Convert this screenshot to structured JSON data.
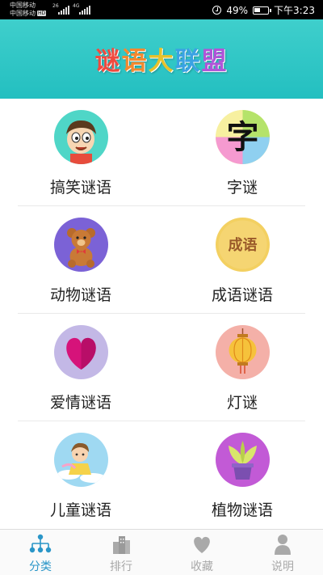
{
  "status_bar": {
    "carrier_1": "中国移动",
    "carrier_2": "中国移动",
    "hd_badge": "HD",
    "net_1": "26",
    "net_2": "4G",
    "battery_percent": "49%",
    "battery_level": 0.49,
    "time": "下午3:23"
  },
  "header": {
    "title_chars": [
      "谜",
      "语",
      "大",
      "联",
      "盟"
    ]
  },
  "categories": [
    {
      "label": "搞笑谜语",
      "icon": "funny-boy-icon",
      "bg": "#4fd6c7"
    },
    {
      "label": "字谜",
      "icon": "character-zi-icon",
      "bg": "#f7f0a0"
    },
    {
      "label": "动物谜语",
      "icon": "teddy-bear-icon",
      "bg": "#7b62d6"
    },
    {
      "label": "成语谜语",
      "icon": "idiom-chengyu-icon",
      "bg": "#f3d061",
      "icon_text": "成语"
    },
    {
      "label": "爱情谜语",
      "icon": "heart-icon",
      "bg": "#c3b8e6"
    },
    {
      "label": "灯谜",
      "icon": "lantern-icon",
      "bg": "#f4b0a8"
    },
    {
      "label": "儿童谜语",
      "icon": "child-icon",
      "bg": "#9fd9f2"
    },
    {
      "label": "植物谜语",
      "icon": "potted-plant-icon",
      "bg": "#c25ad6"
    }
  ],
  "tabs": [
    {
      "label": "分类",
      "icon": "category-tree-icon",
      "active": true
    },
    {
      "label": "排行",
      "icon": "ranking-buildings-icon",
      "active": false
    },
    {
      "label": "收藏",
      "icon": "favorite-heart-icon",
      "active": false
    },
    {
      "label": "说明",
      "icon": "user-info-icon",
      "active": false
    }
  ],
  "colors": {
    "header_bg": "#2ec6c4",
    "active_tab": "#2a96c8",
    "inactive_tab": "#a9a9a9"
  }
}
